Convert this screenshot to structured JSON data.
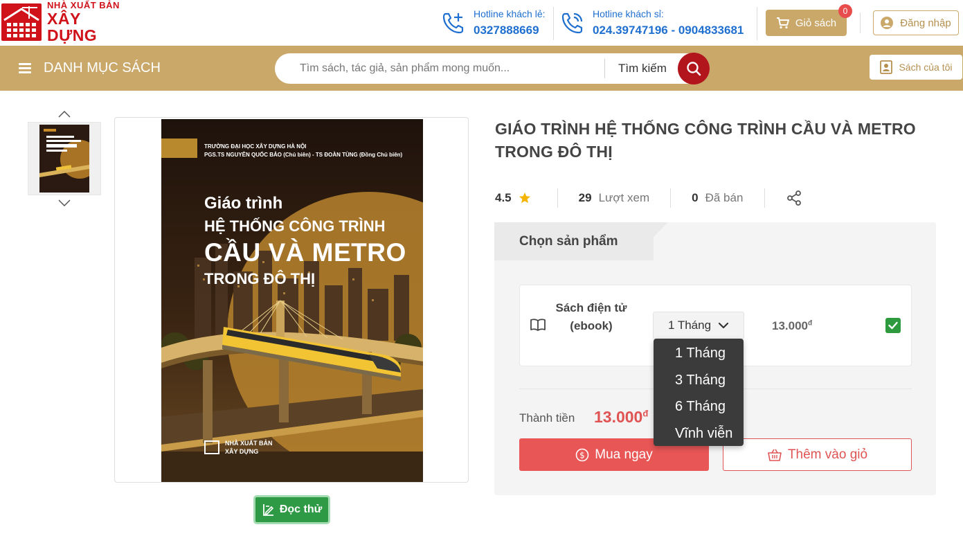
{
  "header": {
    "logo_line1": "NHÀ XUẤT BẢN",
    "logo_line2": "XÂY DỰNG",
    "hotline_retail_label": "Hotline khách lẻ:",
    "hotline_retail_number": "0327888669",
    "hotline_wholesale_label": "Hotline khách sỉ:",
    "hotline_wholesale_number": "024.39747196 - 0904833681",
    "cart_label": "Giỏ sách",
    "cart_count": "0",
    "login_label": "Đăng nhập"
  },
  "nav": {
    "catalog_label": "DANH MỤC SÁCH",
    "search_placeholder": "Tìm sách, tác giả, sản phẩm mong muốn...",
    "search_label": "Tìm kiếm",
    "my_books_label": "Sách của tôi"
  },
  "cover": {
    "publisher_line1": "TRƯỜNG ĐẠI HỌC XÂY DỰNG HÀ NỘI",
    "publisher_line2": "PGS.TS NGUYỄN QUỐC BẢO (Chủ biên) - TS ĐOÀN TÙNG (Đồng Chủ biên)",
    "title_line1": "Giáo trình",
    "title_line2": "HỆ THỐNG CÔNG TRÌNH",
    "title_line3": "CẦU VÀ METRO",
    "title_line4": "TRONG ĐÔ THỊ",
    "logo_line1": "NHÀ XUẤT BẢN",
    "logo_line2": "XÂY DỰNG"
  },
  "read_sample_label": "Đọc thử",
  "product": {
    "title": "GIÁO TRÌNH HỆ THỐNG CÔNG TRÌNH CẦU VÀ METRO TRONG ĐÔ THỊ",
    "rating": "4.5",
    "views_count": "29",
    "views_label": "Lượt xem",
    "sold_count": "0",
    "sold_label": "Đã bán"
  },
  "purchase": {
    "tab_label": "Chọn sản phẩm",
    "option_name": "Sách điện tử (ebook)",
    "selected_duration": "1 Tháng",
    "option_price": "13.000",
    "currency": "đ",
    "total_label": "Thành tiền",
    "total_value": "13.000",
    "buy_now_label": "Mua ngay",
    "add_to_cart_label": "Thêm vào giỏ"
  },
  "duration_options": [
    "1 Tháng",
    "3 Tháng",
    "6 Tháng",
    "Vĩnh viễn"
  ],
  "colors": {
    "brand_red": "#d0121a",
    "gold": "#c9a86a",
    "hotline_blue": "#1e6fd0",
    "price_red": "#e05353",
    "check_green": "#2e9a3e"
  }
}
